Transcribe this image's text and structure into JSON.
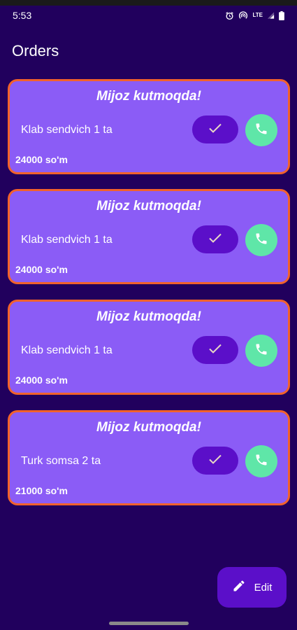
{
  "status_bar": {
    "time": "5:53",
    "network_label": "LTE",
    "icons": [
      "alarm-icon",
      "hotspot-icon",
      "lte-icon",
      "signal-icon",
      "battery-icon"
    ]
  },
  "header": {
    "title": "Orders"
  },
  "orders": [
    {
      "status": "Mijoz kutmoqda!",
      "item": "Klab sendvich 1 ta",
      "price": "24000 so'm"
    },
    {
      "status": "Mijoz kutmoqda!",
      "item": "Klab sendvich 1 ta",
      "price": "24000 so'm"
    },
    {
      "status": "Mijoz kutmoqda!",
      "item": "Klab sendvich 1 ta",
      "price": "24000 so'm"
    },
    {
      "status": "Mijoz kutmoqda!",
      "item": "Turk somsa 2 ta",
      "price": "21000 so'm"
    }
  ],
  "fab": {
    "label": "Edit",
    "icon": "pencil-icon"
  },
  "colors": {
    "background": "#21005D",
    "card": "#8B5CF6",
    "card_border": "#F2622B",
    "done_button": "#5B0FC9",
    "call_button": "#5FE6A8",
    "fab": "#5B0FC9"
  }
}
